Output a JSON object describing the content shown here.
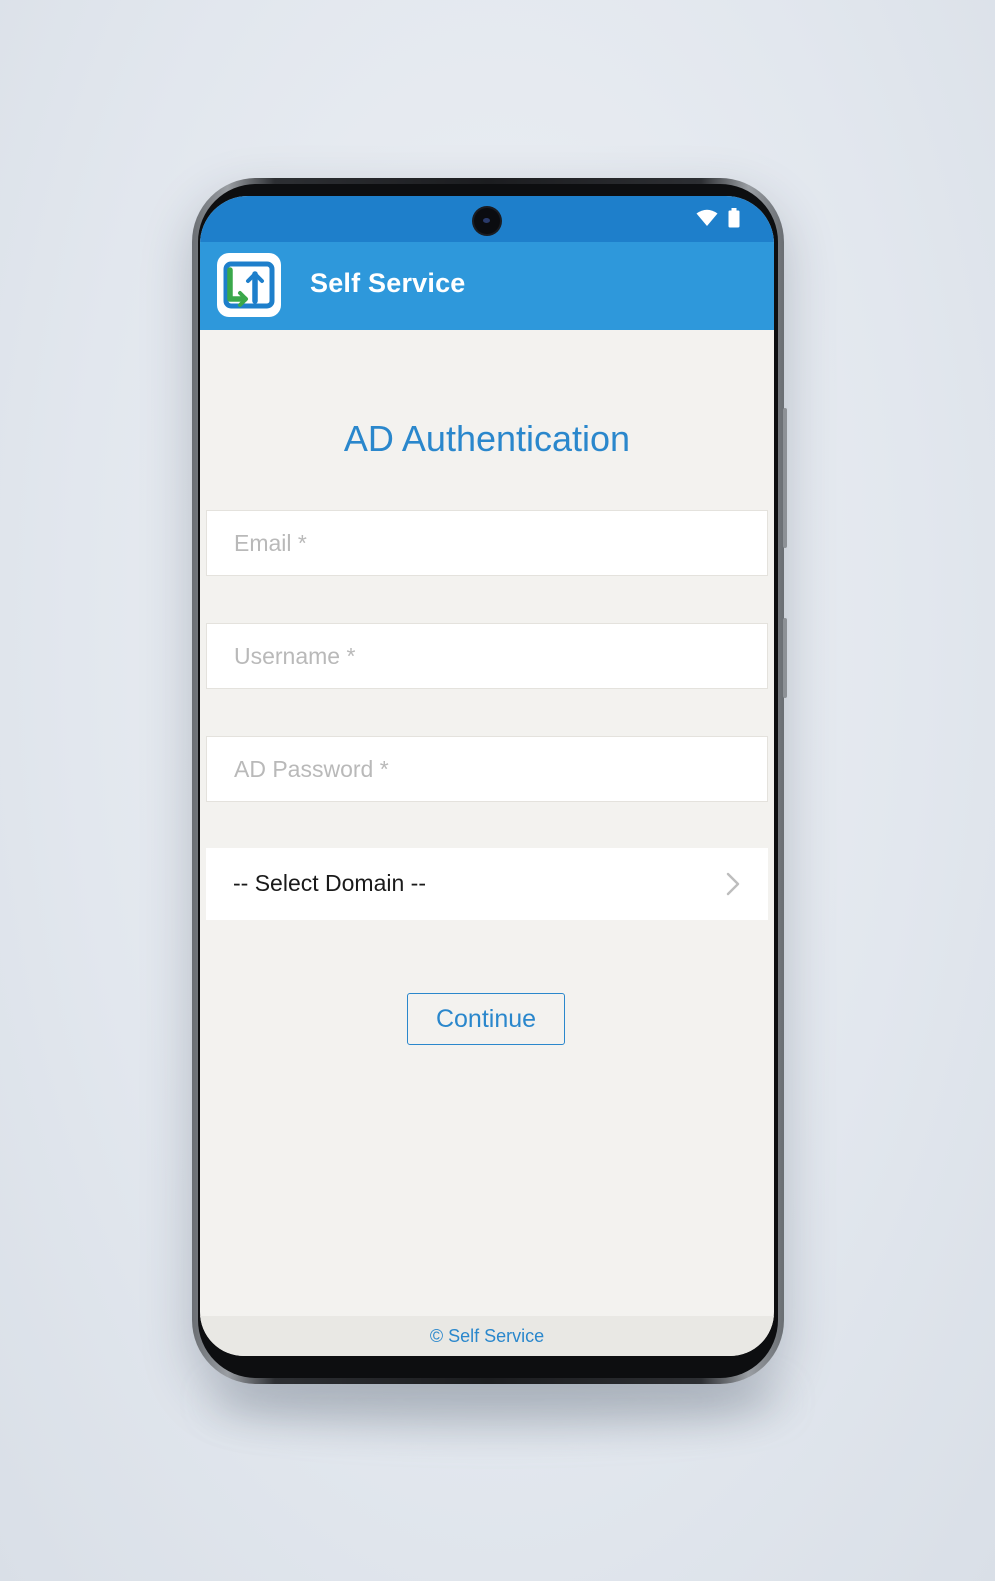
{
  "app": {
    "title": "Self Service",
    "logo_icon": "self-service-logo-icon"
  },
  "status_bar": {
    "icons": [
      "wifi-icon",
      "battery-icon"
    ]
  },
  "page": {
    "heading": "AD Authentication"
  },
  "form": {
    "email": {
      "placeholder": "Email *",
      "value": ""
    },
    "username": {
      "placeholder": "Username *",
      "value": ""
    },
    "password": {
      "placeholder": "AD Password *",
      "value": ""
    },
    "domain": {
      "selected": "-- Select Domain --",
      "icon": "chevron-right-icon"
    },
    "continue_label": "Continue"
  },
  "footer": {
    "text": "© Self Service"
  },
  "colors": {
    "status_bar": "#1e7fcb",
    "app_bar": "#2e98db",
    "accent": "#2a87cc",
    "background": "#f3f2ef",
    "logo_green": "#3aa84a",
    "logo_blue": "#1e7fcb"
  }
}
